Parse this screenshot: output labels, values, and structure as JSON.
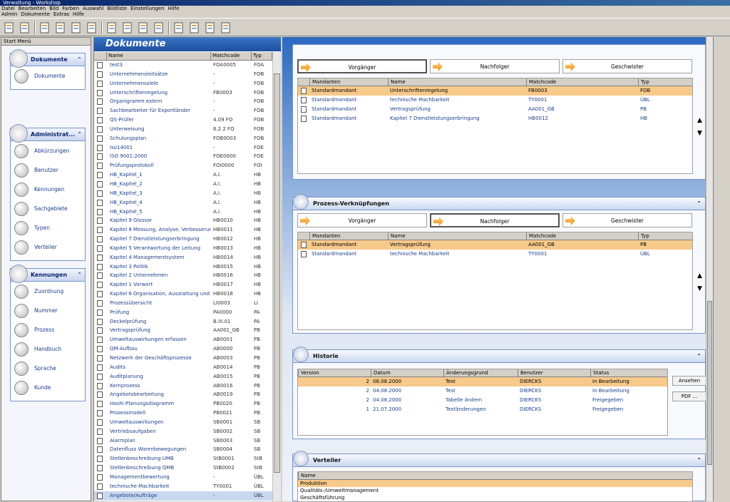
{
  "window": {
    "title": "Verwaltung - Workshop"
  },
  "menu": {
    "row1": [
      "Datei",
      "Bearbeiten",
      "Bild",
      "Farben",
      "Auswahl",
      "Bildliste",
      "Einstellungen",
      "Hilfe"
    ],
    "row2": [
      "Admin",
      "Dokumente",
      "Extras",
      "Hilfe"
    ]
  },
  "startmenu": {
    "label": "Start Menü",
    "groups": [
      {
        "title": "Dokumente",
        "items": [
          "Dokumente"
        ]
      },
      {
        "title": "Administrat...",
        "items": [
          "Abkürzungen",
          "Benutzer",
          "Kennungen",
          "Sachgebiete",
          "Typen",
          "Verteiler"
        ]
      },
      {
        "title": "Kennungen",
        "items": [
          "Zuordnung",
          "Nummer",
          "Prozess",
          "Handbuch",
          "Sprache",
          "Kunde"
        ]
      }
    ]
  },
  "documents": {
    "title": "Dokumente",
    "columns": [
      "Name",
      "Matchcode",
      "Typ"
    ],
    "rows": [
      [
        "test3",
        "FOA0005",
        "FOA"
      ],
      [
        "Unternehmensleitsätze",
        "-",
        "FOB"
      ],
      [
        "Unternehmensziele",
        "-",
        "FOB"
      ],
      [
        "Unterschriftenregelung",
        "FB0003",
        "FOB"
      ],
      [
        "Organigramm extern",
        "-",
        "FOB"
      ],
      [
        "Sachbearbeiter für Exportländer",
        "-",
        "FOB"
      ],
      [
        "QS-Prüfer",
        "4.09 FO",
        "FOB"
      ],
      [
        "Unterweisung",
        "6.2.2 FO",
        "FOB"
      ],
      [
        "Schulungsplan",
        "FOB0003",
        "FOB"
      ],
      [
        "Iso14001",
        "-",
        "FOE"
      ],
      [
        "ISO 9001:2000",
        "FOE0000",
        "FOE"
      ],
      [
        "Prüfungsprotokoll",
        "FOI0000",
        "FOI"
      ],
      [
        "HB_Kapitel_1",
        "A.I.",
        "HB"
      ],
      [
        "HB_Kapitel_2",
        "A.I.",
        "HB"
      ],
      [
        "HB_Kapitel_3",
        "A.I.",
        "HB"
      ],
      [
        "HB_Kapitel_4",
        "A.I.",
        "HB"
      ],
      [
        "HB_Kapitel_5",
        "A.I.",
        "HB"
      ],
      [
        "Kapitel 9 Glossar",
        "HB0010",
        "HB"
      ],
      [
        "Kapitel 8 Messung, Analyse, Verbesserung",
        "HB0011",
        "HB"
      ],
      [
        "Kapitel 7 Dienstleistungserbringung",
        "HB0012",
        "HB"
      ],
      [
        "Kapitel 5 Verantwortung der Leitung",
        "HB0013",
        "HB"
      ],
      [
        "Kapitel 4 Managementsystem",
        "HB0014",
        "HB"
      ],
      [
        "Kapitel 3 Politik",
        "HB0015",
        "HB"
      ],
      [
        "Kapitel 2 Unternehmen",
        "HB0016",
        "HB"
      ],
      [
        "Kapitel 1 Vorwort",
        "HB0017",
        "HB"
      ],
      [
        "Kapitel 6 Organisation, Ausstattung und ...",
        "HB0018",
        "HB"
      ],
      [
        "Prozessübersicht",
        "LI0003",
        "LI"
      ],
      [
        "Prüfung",
        "PA0000",
        "PA"
      ],
      [
        "Deckelprüfung",
        "B.III.01",
        "PA"
      ],
      [
        "Vertragsprüfung",
        "AA001_GB",
        "PB"
      ],
      [
        "Umweltauswirkungen erfassen",
        "AB0001",
        "PB"
      ],
      [
        "QM-Aufbau",
        "AB0000",
        "PB"
      ],
      [
        "Netzwerk der Geschäftsprozesse",
        "AB0003",
        "PB"
      ],
      [
        "Audits",
        "AB0014",
        "PB"
      ],
      [
        "Auditplanung",
        "AB0015",
        "PB"
      ],
      [
        "Kernprozess",
        "AB0016",
        "PB"
      ],
      [
        "Angebotsbearbeitung",
        "AB0019",
        "PB"
      ],
      [
        "Hoshi-Planungsdiagramm",
        "PB0020",
        "PB"
      ],
      [
        "Prozessmodell",
        "PB0021",
        "PB"
      ],
      [
        "Umweltauswirkungen",
        "SB0001",
        "SB"
      ],
      [
        "Vertriebsaufgaben",
        "SB0002",
        "SB"
      ],
      [
        "Alarmplan",
        "SB0003",
        "SB"
      ],
      [
        "Datenfluss Warenbewegungen",
        "SB0004",
        "SB"
      ],
      [
        "Stellenbeschreibung UMB",
        "StB0001",
        "StB"
      ],
      [
        "Stellenbeschreibung QMB",
        "StB0002",
        "StB"
      ],
      [
        "Managementbewertung",
        "-",
        "ÜBL"
      ],
      [
        "technische Machbarkeit",
        "TY0001",
        "ÜBL"
      ],
      [
        "Angebote/Aufträge",
        "-",
        "ÜBL"
      ]
    ]
  },
  "links": {
    "nav": [
      "Vorgänger",
      "Nachfolger",
      "Geschwister"
    ],
    "columns": [
      "Mandanten",
      "Name",
      "Matchcode",
      "Typ"
    ],
    "rows": [
      [
        "Standardmandant",
        "Unterschriftenregelung",
        "FB0003",
        "FOB"
      ],
      [
        "Standardmandant",
        "technische Machbarkeit",
        "TY0001",
        "ÜBL"
      ],
      [
        "Standardmandant",
        "Vertragsprüfung",
        "AA001_GB",
        "PB"
      ],
      [
        "Standardmandant",
        "Kapitel 7 Dienstleistungserbringung",
        "HB0012",
        "HB"
      ]
    ]
  },
  "process": {
    "title": "Prozess-Verknüpfungen",
    "nav": [
      "Vorgänger",
      "Nachfolger",
      "Geschwister"
    ],
    "columns": [
      "Mandanten",
      "Name",
      "Matchcode",
      "Typ"
    ],
    "rows": [
      [
        "Standardmandant",
        "Vertragsprüfung",
        "AA001_GB",
        "PB"
      ],
      [
        "Standardmandant",
        "technische Machbarkeit",
        "TY0001",
        "ÜBL"
      ]
    ]
  },
  "history": {
    "title": "Historie",
    "columns": [
      "Version",
      "Datum",
      "Änderungsgrund",
      "Benutzer",
      "Status"
    ],
    "rows": [
      [
        "2",
        "06.08.2000",
        "Test",
        "DIERCKS",
        "In Bearbeitung"
      ],
      [
        "2",
        "04.08.2000",
        "Test",
        "DIERCKS",
        "In Bearbeitung"
      ],
      [
        "2",
        "04.08.2000",
        "Tabelle ändern",
        "DIERCKS",
        "Freigegeben"
      ],
      [
        "1",
        "21.07.2000",
        "Textänderungen",
        "DIERCKS",
        "Freigegeben"
      ]
    ],
    "buttons": {
      "view": "Ansehen",
      "pdf": "PDF ..."
    }
  },
  "distribution": {
    "title": "Verteiler",
    "column": "Name",
    "rows": [
      "Produktion",
      "Qualitäts-/Umweltmanagement",
      "Geschäftsführung"
    ]
  },
  "colors": {
    "accent": "#1d4fa0",
    "selection": "#f7c98a"
  }
}
